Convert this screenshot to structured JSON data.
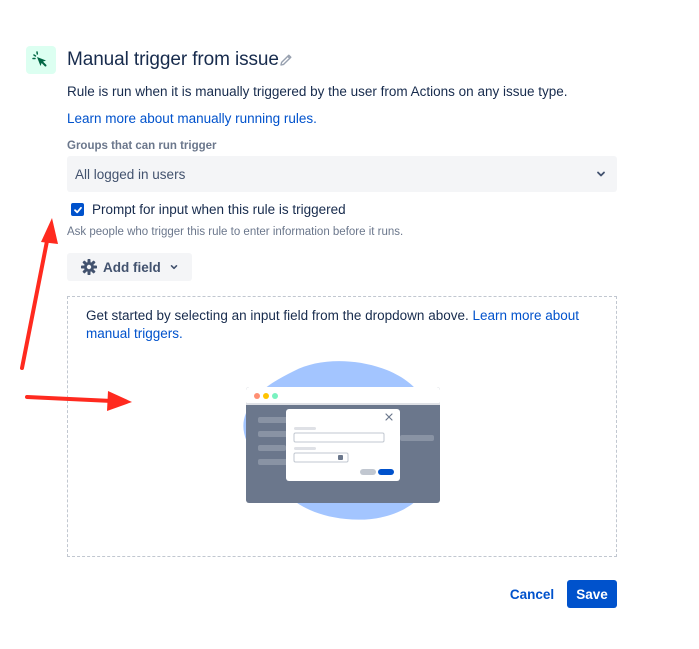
{
  "header": {
    "title": "Manual trigger from issue",
    "description": "Rule is run when it is manually triggered by the user from Actions on any issue type.",
    "learn_more_link": "Learn more about manually running rules."
  },
  "groups": {
    "label": "Groups that can run trigger",
    "selected": "All logged in users"
  },
  "prompt": {
    "checked": true,
    "label": "Prompt for input when this rule is triggered",
    "helper": "Ask people who trigger this rule to enter information before it runs."
  },
  "add_field": {
    "label": "Add field"
  },
  "empty_state": {
    "text": "Get started by selecting an input field from the dropdown above. ",
    "link": "Learn more about manual triggers."
  },
  "footer": {
    "cancel_label": "Cancel",
    "save_label": "Save"
  },
  "colors": {
    "primary": "#0052cc",
    "text": "#172b4d",
    "subtle_text": "#6b778c",
    "trigger_icon_bg": "#dcfff1",
    "trigger_icon_fg": "#006644",
    "annotation_arrow": "#ff2a1f"
  },
  "icons": [
    "cursor-click-icon",
    "pencil-icon",
    "chevron-down-icon",
    "checkmark-icon",
    "gear-icon",
    "chevron-down-icon"
  ]
}
